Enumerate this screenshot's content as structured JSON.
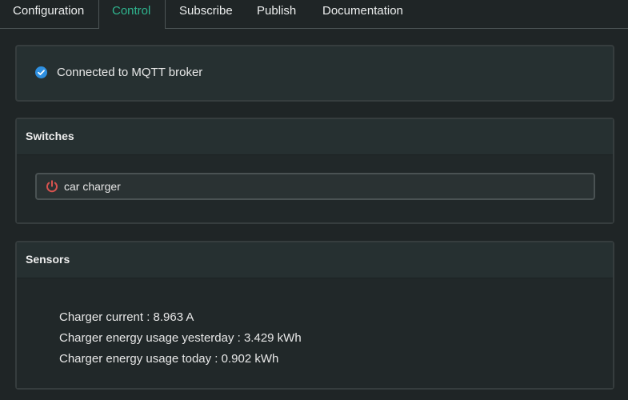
{
  "tabs": [
    {
      "label": "Configuration"
    },
    {
      "label": "Control",
      "active": true
    },
    {
      "label": "Subscribe"
    },
    {
      "label": "Publish"
    },
    {
      "label": "Documentation"
    }
  ],
  "status": {
    "text": "Connected to MQTT broker",
    "icon": "check-circle-icon",
    "color": "#2e8fe0"
  },
  "switches": {
    "title": "Switches",
    "items": [
      {
        "label": "car charger",
        "icon": "power-icon",
        "color": "#d9534f"
      }
    ]
  },
  "sensors": {
    "title": "Sensors",
    "lines": [
      "Charger current : 8.963 A",
      "Charger energy usage yesterday : 3.429 kWh",
      "Charger energy usage today : 0.902 kWh"
    ]
  },
  "colors": {
    "accent": "#2fb58f",
    "background": "#1f2526"
  }
}
